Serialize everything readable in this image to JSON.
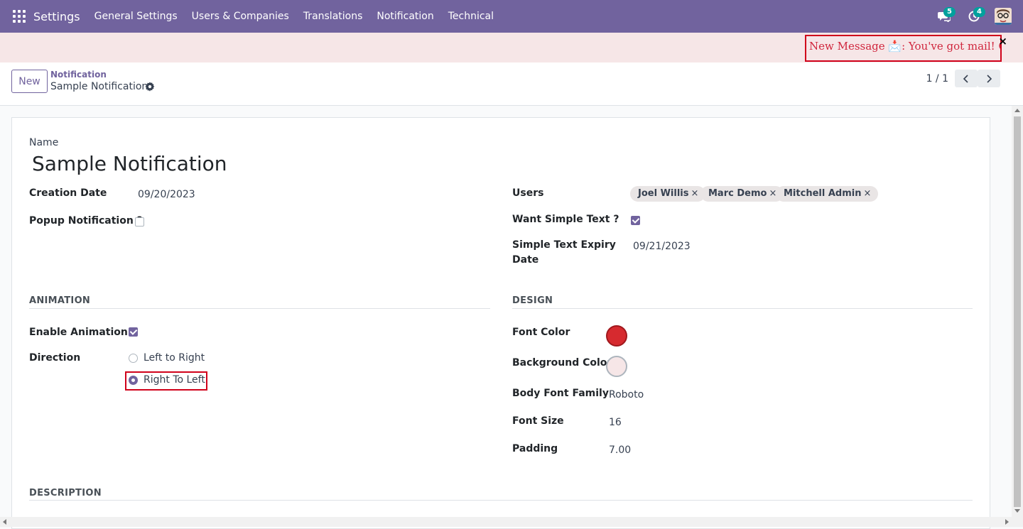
{
  "navbar": {
    "brand": "Settings",
    "menu": [
      "General Settings",
      "Users & Companies",
      "Translations",
      "Notification",
      "Technical"
    ],
    "messages_count": "5",
    "activities_count": "4"
  },
  "notification_banner": {
    "message": "New Message 📩: You've got mail! Check y",
    "close": "×",
    "text_color": "#d0263d",
    "bg_color": "#f6e6e7"
  },
  "control_panel": {
    "new_label": "New",
    "breadcrumb_parent": "Notification",
    "breadcrumb_current": "Sample Notification",
    "pager": "1 / 1"
  },
  "form": {
    "name_label": "Name",
    "name_value": "Sample Notification",
    "creation_date_label": "Creation Date",
    "creation_date_value": "09/20/2023",
    "popup_label": "Popup Notification ?",
    "popup_checked": false,
    "users_label": "Users",
    "users": [
      "Joel Willis",
      "Marc Demo",
      "Mitchell Admin"
    ],
    "want_simple_text_label": "Want Simple Text ?",
    "want_simple_text_checked": true,
    "expiry_label_1": "Simple Text Expiry",
    "expiry_label_2": "Date",
    "expiry_value": "09/21/2023",
    "animation_title": "ANIMATION",
    "enable_animation_label": "Enable Animation ?",
    "enable_animation_checked": true,
    "direction_label": "Direction",
    "direction_options": [
      "Left to Right",
      "Right To Left"
    ],
    "direction_selected": "Right To Left",
    "design_title": "DESIGN",
    "font_color_label": "Font Color",
    "font_color_value": "#d62a2f",
    "bg_color_label": "Background Color",
    "bg_color_value": "#f6e6e7",
    "body_font_label": "Body Font Family",
    "body_font_value": "Roboto",
    "font_size_label": "Font Size",
    "font_size_value": "16",
    "padding_label": "Padding",
    "padding_value": "7.00",
    "description_title": "DESCRIPTION"
  }
}
